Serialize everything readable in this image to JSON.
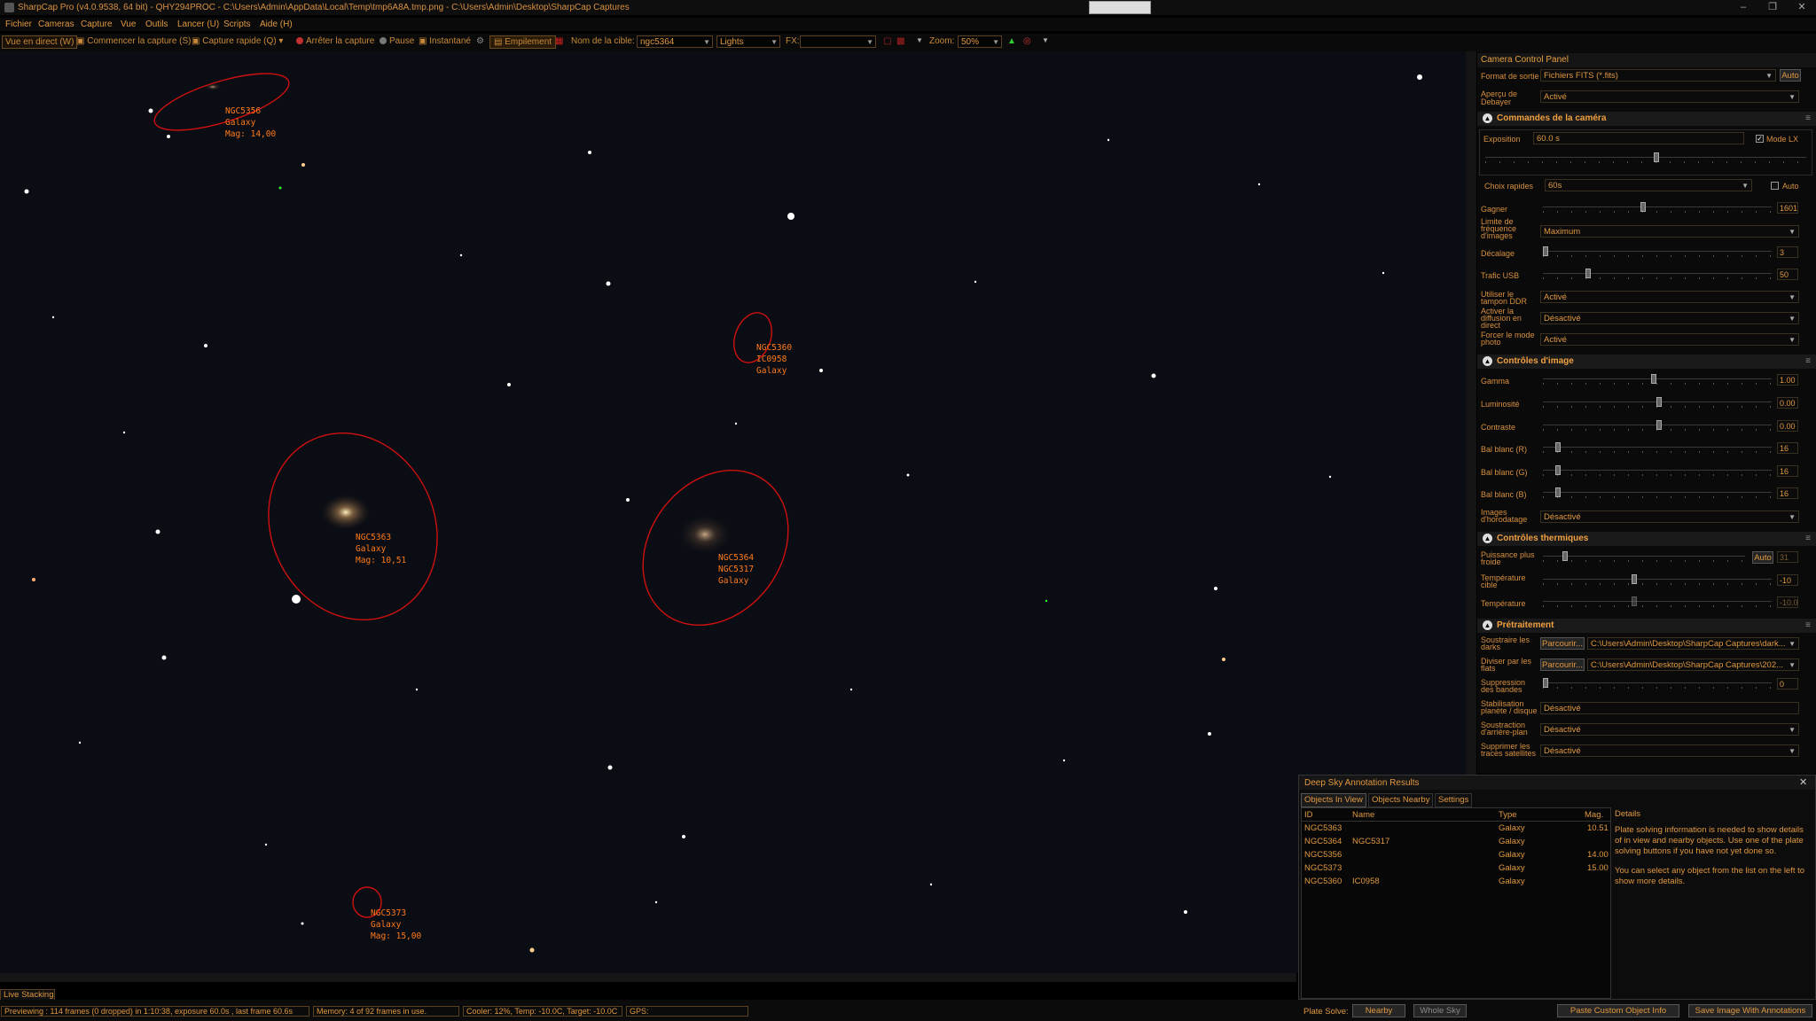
{
  "window": {
    "title": "SharpCap Pro (v4.0.9538, 64 bit) - QHY294PROC - C:\\Users\\Admin\\AppData\\Local\\Temp\\tmp6A8A.tmp.png - C:\\Users\\Admin\\Desktop\\SharpCap Captures",
    "min": "–",
    "max": "❐",
    "close": "✕"
  },
  "menu": [
    "Fichier",
    "Cameras",
    "Capture",
    "Vue",
    "Outils",
    "Lancer (U)",
    "Scripts",
    "Aide (H)"
  ],
  "toolbar": {
    "live": "Vue en direct (W)",
    "start": "Commencer la capture (S)",
    "quick": "Capture rapide (Q)",
    "stop": "Arrêter la capture",
    "pause": "Pause",
    "snap": "Instantané",
    "stack": "Empilement",
    "target_label": "Nom de la cible:",
    "target_value": "ngc5364",
    "frame_type": "Lights",
    "fx_label": "FX:",
    "fx_value": "",
    "zoom_label": "Zoom:",
    "zoom_value": "50%"
  },
  "annotations": [
    {
      "lines": "NGC5356\nGalaxy\nMag: 14,00"
    },
    {
      "lines": "NGC5360\nIC0958\nGalaxy"
    },
    {
      "lines": "NGC5363\nGalaxy\nMag: 10,51"
    },
    {
      "lines": "NGC5364\nNGC5317\nGalaxy"
    },
    {
      "lines": "NGC5373\nGalaxy\nMag: 15,00"
    }
  ],
  "panel": {
    "title": "Camera Control Panel",
    "format_label": "Format de sortie",
    "format_value": "Fichiers FITS (*.fits)",
    "auto": "Auto",
    "debayer_label": "Aperçu de Debayer",
    "debayer_value": "Activé",
    "sec_camera": "Commandes de la caméra",
    "exposure_label": "Exposition",
    "exposure_value": "60.0 s",
    "lx_label": "Mode LX",
    "quick_label": "Choix rapides",
    "quick_value": "60s",
    "quick_auto": "Auto",
    "gain_label": "Gagner",
    "gain_value": "1601",
    "framerate_label": "Limite de fréquence d'images",
    "framerate_value": "Maximum",
    "offset_label": "Décalage",
    "offset_value": "3",
    "usb_label": "Trafic USB",
    "usb_value": "50",
    "ddr_label": "Utiliser le tampon DDR",
    "ddr_value": "Activé",
    "live_label": "Activer la diffusion en direct",
    "live_value": "Désactivé",
    "photo_label": "Forcer le mode photo",
    "photo_value": "Activé",
    "sec_image": "Contrôles d'image",
    "gamma_label": "Gamma",
    "gamma_value": "1.00",
    "lum_label": "Luminosité",
    "lum_value": "0.00",
    "contrast_label": "Contraste",
    "contrast_value": "0.00",
    "wbr_label": "Bal blanc (R)",
    "wbr_value": "16",
    "wbg_label": "Bal blanc (G)",
    "wbg_value": "16",
    "wbb_label": "Bal blanc (B)",
    "wbb_value": "16",
    "ts_label": "Images d'horodatage",
    "ts_value": "Désactivé",
    "sec_thermal": "Contrôles thermiques",
    "cool_label": "Puissance plus froide",
    "cool_auto": "Auto",
    "cool_value": "31",
    "target_temp_label": "Température cible",
    "target_temp_value": "-10",
    "temp_label": "Température",
    "temp_value": "-10.0",
    "sec_pre": "Prétraitement",
    "darks_label": "Soustraire les darks",
    "browse": "Parcourir...",
    "darks_path": "C:\\Users\\Admin\\Desktop\\SharpCap Captures\\dark...",
    "flats_label": "Diviser par les flats",
    "flats_path": "C:\\Users\\Admin\\Desktop\\SharpCap Captures\\202...",
    "banding_label": "Suppression des bandes",
    "banding_value": "0",
    "stab_label": "Stabilisation planète / disque",
    "stab_value": "Désactivé",
    "bg_label": "Soustraction d'arrière-plan",
    "bg_value": "Désactivé",
    "sat_label": "Supprimer les traces satellites",
    "sat_value": "Désactivé"
  },
  "dso": {
    "title": "Deep Sky Annotation Results",
    "tabs": [
      "Objects In View",
      "Objects Nearby",
      "Settings"
    ],
    "columns": [
      "ID",
      "Name",
      "Type",
      "Mag."
    ],
    "rows": [
      {
        "id": "NGC5363",
        "name": "",
        "type": "Galaxy",
        "mag": "10.51"
      },
      {
        "id": "NGC5364",
        "name": "NGC5317",
        "type": "Galaxy",
        "mag": ""
      },
      {
        "id": "NGC5356",
        "name": "",
        "type": "Galaxy",
        "mag": "14.00"
      },
      {
        "id": "NGC5373",
        "name": "",
        "type": "Galaxy",
        "mag": "15.00"
      },
      {
        "id": "NGC5360",
        "name": "IC0958",
        "type": "Galaxy",
        "mag": ""
      }
    ],
    "details_title": "Details",
    "details_p1": "Plate solving information is needed to show details of in view and nearby objects. Use one of the plate solving buttons if you have not yet done so.",
    "details_p2": "You can select any object from the list on the left to show more details."
  },
  "status": {
    "live_tab": "Live Stacking",
    "preview": "Previewing : 114 frames (0 dropped) in 1:10:38, exposure 60.0s , last frame 60.6s",
    "memory": "Memory: 4 of 92 frames in use.",
    "cooler": "Cooler: 12%, Temp: -10.0C, Target: -10.0C",
    "gps": "GPS:",
    "plate_label": "Plate Solve:",
    "nearby": "Nearby",
    "whole": "Whole Sky",
    "paste": "Paste Custom Object Info",
    "save": "Save Image With Annotations"
  },
  "colors": {
    "accent": "#e8a040",
    "annotation": "#ff7a1a",
    "ellipse": "#d01010"
  }
}
